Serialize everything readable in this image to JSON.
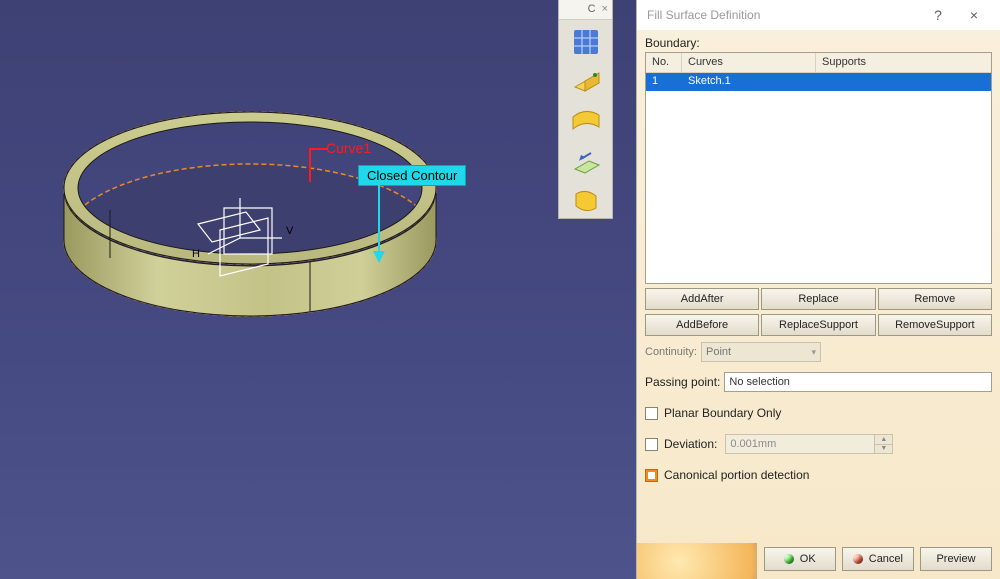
{
  "dialog": {
    "title": "Fill Surface Definition",
    "boundary_label": "Boundary:",
    "columns": {
      "no": "No.",
      "curves": "Curves",
      "supports": "Supports"
    },
    "rows": [
      {
        "no": "1",
        "curve": "Sketch.1",
        "support": ""
      }
    ],
    "buttons": {
      "add_after": "AddAfter",
      "replace": "Replace",
      "remove": "Remove",
      "add_before": "AddBefore",
      "replace_support": "ReplaceSupport",
      "remove_support": "RemoveSupport"
    },
    "continuity_label": "Continuity:",
    "continuity_value": "Point",
    "passing_point_label": "Passing point:",
    "passing_point_value": "No selection",
    "planar_boundary": "Planar Boundary Only",
    "deviation_label": "Deviation:",
    "deviation_value": "0.001mm",
    "canonical": "Canonical portion detection",
    "ok": "OK",
    "cancel": "Cancel",
    "preview": "Preview",
    "help_glyph": "?",
    "close_glyph": "×"
  },
  "viewport": {
    "curve_label": "Curve1",
    "tooltip": "Closed Contour",
    "axis_h": "H",
    "axis_v": "V"
  },
  "toolbar": {
    "tab_label": "C",
    "close_glyph": "×",
    "icons": [
      "grid-icon",
      "extrude-icon",
      "sweep-icon",
      "offset-icon",
      "fill-icon"
    ]
  }
}
